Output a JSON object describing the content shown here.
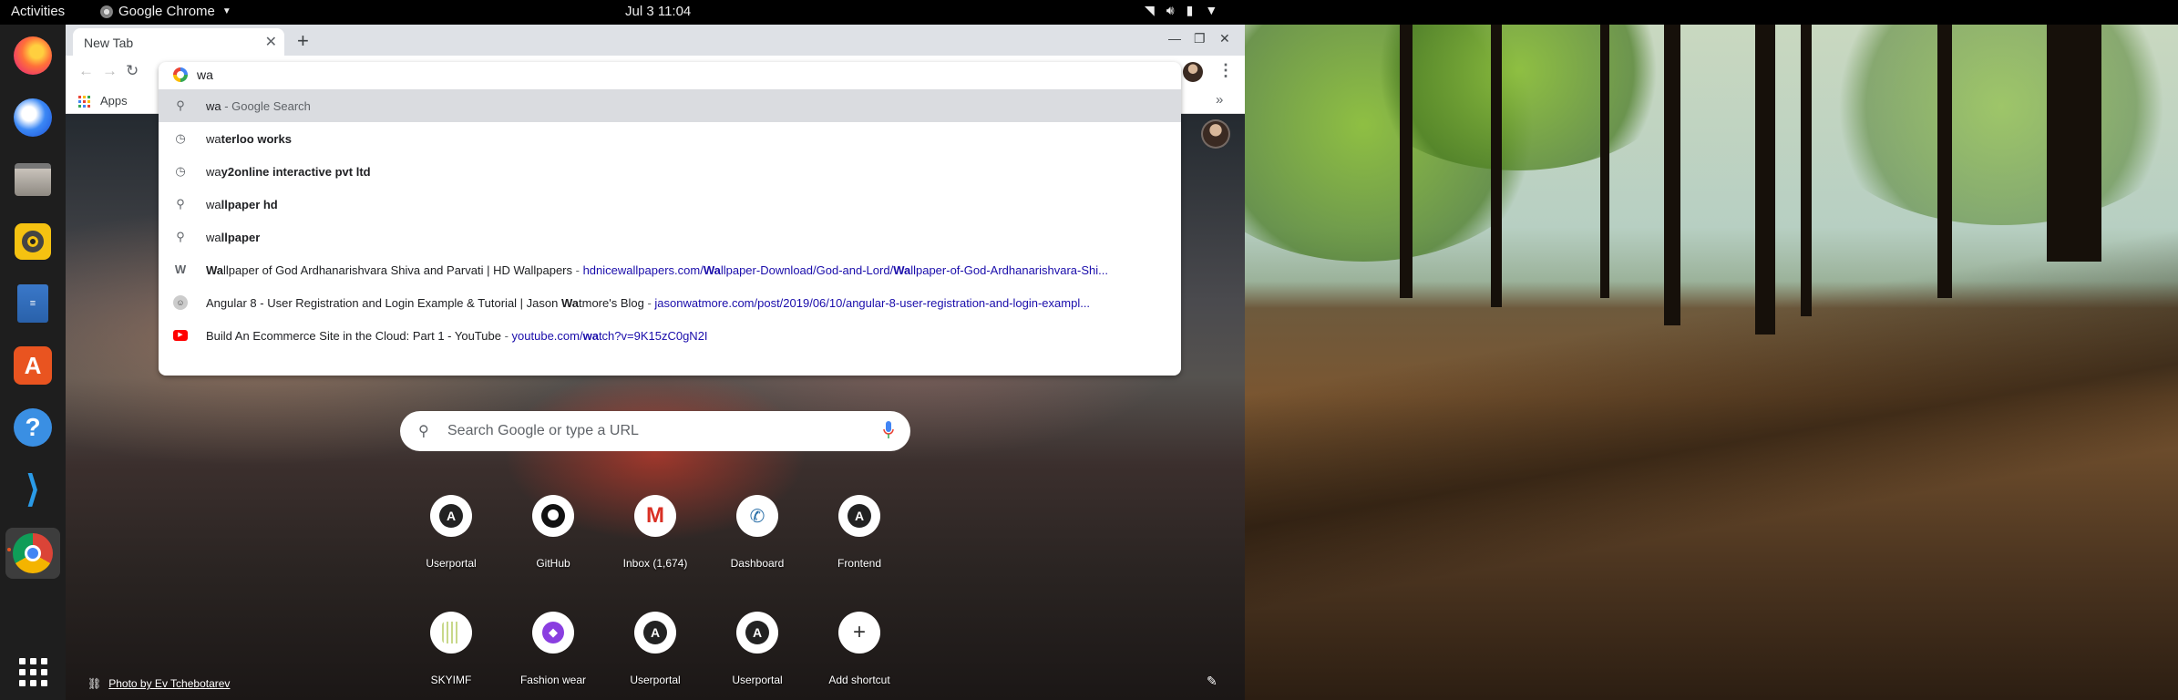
{
  "topbar": {
    "activities": "Activities",
    "app_name": "Google Chrome",
    "clock": "Jul 3  11:04",
    "icons": [
      "wifi-icon",
      "volume-icon",
      "battery-icon",
      "power-icon"
    ]
  },
  "dock": {
    "items": [
      "firefox",
      "thunderbird",
      "files",
      "rhythmbox",
      "libreoffice-writer",
      "ubuntu-software",
      "help",
      "vscode",
      "chrome",
      "show-applications"
    ],
    "active": "chrome"
  },
  "chrome": {
    "tab_title": "New Tab",
    "new_tab_symbol": "+",
    "window_controls": [
      "minimize",
      "maximize",
      "close"
    ],
    "bookmarks": {
      "apps_label": "Apps",
      "overflow_symbol": "»"
    },
    "omnibox": {
      "input_value": "wa",
      "suggestions": [
        {
          "kind": "search",
          "icon": "search-icon",
          "typed": "wa",
          "rest": "",
          "suffix": " - Google Search"
        },
        {
          "kind": "history",
          "icon": "history-icon",
          "typed": "wa",
          "rest": "terloo works"
        },
        {
          "kind": "history",
          "icon": "history-icon",
          "typed": "wa",
          "rest": "y2online interactive pvt ltd"
        },
        {
          "kind": "search",
          "icon": "search-icon",
          "typed": "wa",
          "rest": "llpaper hd"
        },
        {
          "kind": "search",
          "icon": "search-icon",
          "typed": "wa",
          "rest": "llpaper"
        },
        {
          "kind": "page",
          "icon": "wallpapers-favicon",
          "title_pre": "",
          "title_bold": "Wa",
          "title_post": "llpaper of God Ardhanarishvara Shiva and Parvati | HD Wallpapers",
          "url_pre": "hdnicewallpapers.com/",
          "url_bold1": "Wa",
          "url_mid": "llpaper-Download/God-and-Lord/",
          "url_bold2": "Wa",
          "url_post": "llpaper-of-God-Ardhanarishvara-Shi..."
        },
        {
          "kind": "page",
          "icon": "jasonwatmore-favicon",
          "title_pre": "Angular 8 - User Registration and Login Example & Tutorial | Jason ",
          "title_bold": "Wa",
          "title_post": "tmore's Blog",
          "url_pre": "jasonwatmore.com/post/2019/06/10/angular-8-user-registration-and-login-exampl...",
          "url_bold1": "",
          "url_mid": "",
          "url_bold2": "",
          "url_post": ""
        },
        {
          "kind": "page",
          "icon": "youtube-favicon",
          "title_pre": "Build An Ecommerce Site in the Cloud: Part 1 - YouTube",
          "title_bold": "",
          "title_post": "",
          "url_pre": "youtube.com/",
          "url_bold1": "wa",
          "url_mid": "tch?v=9K15zC0gN2I",
          "url_bold2": "",
          "url_post": ""
        }
      ]
    },
    "ntp": {
      "search_placeholder": "Search Google or type a URL",
      "shortcuts": [
        {
          "label": "Userportal",
          "icon": "angular-icon"
        },
        {
          "label": "GitHub",
          "icon": "github-icon"
        },
        {
          "label": "Inbox (1,674)",
          "icon": "gmail-icon"
        },
        {
          "label": "Dashboard",
          "icon": "dashboard-icon"
        },
        {
          "label": "Frontend",
          "icon": "angular-icon"
        },
        {
          "label": "SKYIMF",
          "icon": "skyimf-icon"
        },
        {
          "label": "Fashion wear",
          "icon": "fashion-icon"
        },
        {
          "label": "Userportal",
          "icon": "angular-icon"
        },
        {
          "label": "Userportal",
          "icon": "angular-icon"
        },
        {
          "label": "Add shortcut",
          "icon": "add-icon"
        }
      ],
      "photo_credit": "Photo by Ev Tchebotarev"
    }
  }
}
